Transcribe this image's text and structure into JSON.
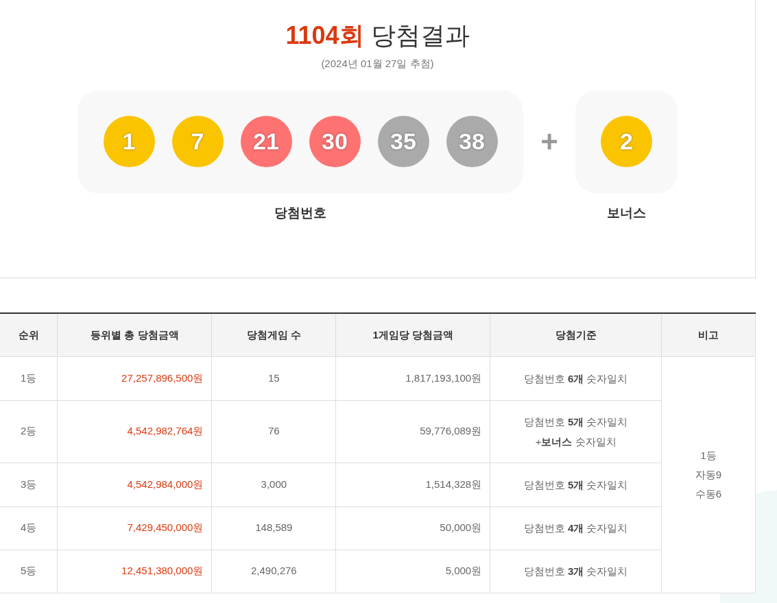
{
  "title": {
    "round": "1104회",
    "label": "당첨결과",
    "date": "(2024년 01월 27일 추첨)"
  },
  "winning_numbers": {
    "label": "당첨번호",
    "balls": [
      {
        "number": "1",
        "color": "#fbc400"
      },
      {
        "number": "7",
        "color": "#fbc400"
      },
      {
        "number": "21",
        "color": "#ff7272"
      },
      {
        "number": "30",
        "color": "#ff7272"
      },
      {
        "number": "35",
        "color": "#aaaaaa"
      },
      {
        "number": "38",
        "color": "#aaaaaa"
      }
    ]
  },
  "plus": "+",
  "bonus": {
    "label": "보너스",
    "ball": {
      "number": "2",
      "color": "#fbc400"
    }
  },
  "table": {
    "columns": [
      "순위",
      "등위별 총 당첨금액",
      "당첨게임 수",
      "1게임당 당첨금액",
      "당첨기준",
      "비고"
    ],
    "rows": [
      {
        "rank": "1등",
        "total": "27,257,896,500원",
        "games": "15",
        "per_game": "1,817,193,100원",
        "criteria": [
          "당첨번호 **6개** 숫자일치"
        ]
      },
      {
        "rank": "2등",
        "total": "4,542,982,764원",
        "games": "76",
        "per_game": "59,776,089원",
        "criteria": [
          "당첨번호 **5개** 숫자일치",
          "+**보너스** 숫자일치"
        ]
      },
      {
        "rank": "3등",
        "total": "4,542,984,000원",
        "games": "3,000",
        "per_game": "1,514,328원",
        "criteria": [
          "당첨번호 **5개** 숫자일치"
        ]
      },
      {
        "rank": "4등",
        "total": "7,429,450,000원",
        "games": "148,589",
        "per_game": "50,000원",
        "criteria": [
          "당첨번호 **4개** 숫자일치"
        ]
      },
      {
        "rank": "5등",
        "total": "12,451,380,000원",
        "games": "2,490,276",
        "per_game": "5,000원",
        "criteria": [
          "당첨번호 **3개** 숫자일치"
        ]
      }
    ],
    "note": [
      "1등",
      "자동9",
      "수동6"
    ]
  }
}
